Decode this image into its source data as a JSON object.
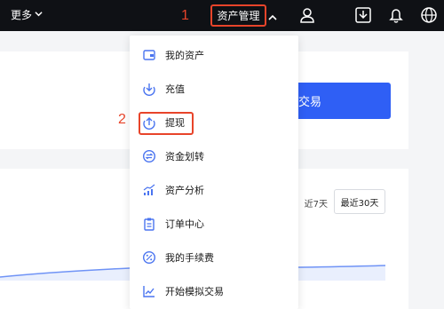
{
  "nav": {
    "more_label": "更多",
    "asset_management_label": "资产管理",
    "icons": [
      "user-icon",
      "download-icon",
      "bell-icon",
      "globe-icon"
    ]
  },
  "annotations": {
    "step1": "1",
    "step2": "2",
    "highlight_color": "#e8442a"
  },
  "background": {
    "trade_button_label": "交易",
    "seg_7d_label": "近7天",
    "seg_30d_label": "最近30天"
  },
  "menu": {
    "items": [
      {
        "label": "我的资产",
        "icon": "wallet-icon"
      },
      {
        "label": "充值",
        "icon": "deposit-icon"
      },
      {
        "label": "提现",
        "icon": "withdraw-icon"
      },
      {
        "label": "资金划转",
        "icon": "transfer-icon"
      },
      {
        "label": "资产分析",
        "icon": "chart-icon"
      },
      {
        "label": "订单中心",
        "icon": "clipboard-icon"
      },
      {
        "label": "我的手续费",
        "icon": "fee-icon"
      },
      {
        "label": "开始模拟交易",
        "icon": "trend-icon"
      }
    ]
  },
  "colors": {
    "nav_bg": "#0f1115",
    "accent_blue": "#2f5ff5",
    "menu_icon_blue": "#4a74f0"
  }
}
